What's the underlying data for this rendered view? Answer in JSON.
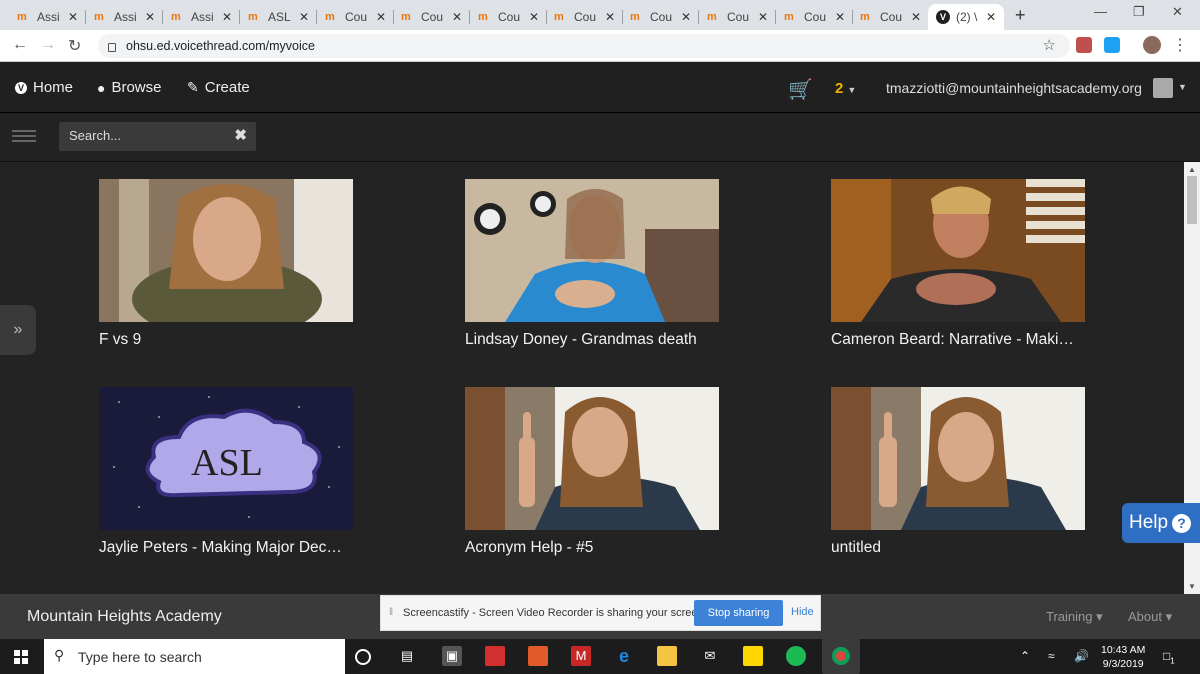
{
  "browser": {
    "tabs": [
      {
        "title": "Assi",
        "active": false
      },
      {
        "title": "Assi",
        "active": false
      },
      {
        "title": "Assi",
        "active": false
      },
      {
        "title": "ASL",
        "active": false
      },
      {
        "title": "Cou",
        "active": false
      },
      {
        "title": "Cou",
        "active": false
      },
      {
        "title": "Cou",
        "active": false
      },
      {
        "title": "Cou",
        "active": false
      },
      {
        "title": "Cou",
        "active": false
      },
      {
        "title": "Cou",
        "active": false
      },
      {
        "title": "Cou",
        "active": false
      },
      {
        "title": "Cou",
        "active": false
      },
      {
        "title": "(2) \\",
        "active": true
      }
    ],
    "url": "ohsu.ed.voicethread.com/myvoice",
    "new_tab_glyph": "+"
  },
  "header": {
    "nav": [
      {
        "label": "Home",
        "icon": "voicethread-logo-icon"
      },
      {
        "label": "Browse",
        "icon": "globe-icon"
      },
      {
        "label": "Create",
        "icon": "pencil-icon"
      }
    ],
    "notification_count": "2",
    "user_email": "tmazziotti@mountainheightsacademy.org"
  },
  "search": {
    "placeholder": "Search..."
  },
  "threads": [
    {
      "title": "F vs 9",
      "thumb": "woman-webcam"
    },
    {
      "title": "Lindsay Doney - Grandmas death",
      "thumb": "woman-signing-blue"
    },
    {
      "title": "Cameron Beard: Narrative - Maki…",
      "thumb": "boy-signing"
    },
    {
      "title": "Jaylie Peters - Making Major Dec…",
      "thumb": "asl-cloud"
    },
    {
      "title": "Acronym Help - #5",
      "thumb": "woman-finger-up"
    },
    {
      "title": "untitled",
      "thumb": "woman-finger-up"
    }
  ],
  "asl_thumb_text": "ASL",
  "help": {
    "label": "Help",
    "icon_glyph": "?"
  },
  "footer": {
    "org_name": "Mountain Heights Academy",
    "links": [
      "Training",
      "About"
    ]
  },
  "screencastify": {
    "message": "Screencastify - Screen Video Recorder is sharing your screen.",
    "stop_label": "Stop sharing",
    "hide_label": "Hide"
  },
  "taskbar": {
    "search_placeholder": "Type here to search",
    "time": "10:43 AM",
    "date": "9/3/2019",
    "notification_badge": "1"
  },
  "colors": {
    "accent_blue": "#2f6fc3",
    "notif_yellow": "#f0b400",
    "header_bg": "#202020"
  }
}
